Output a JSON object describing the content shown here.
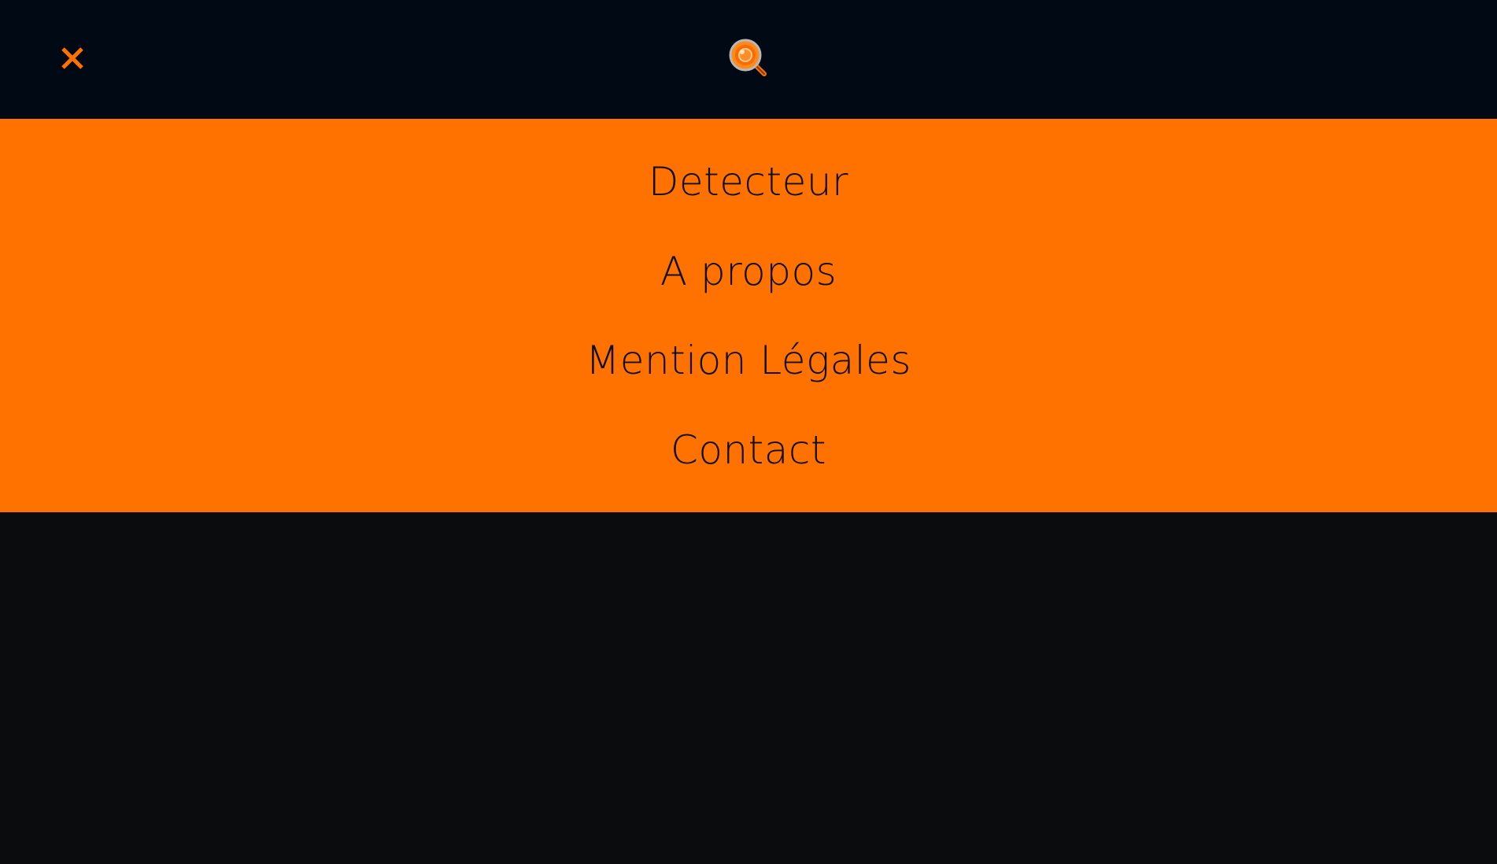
{
  "header": {
    "close_icon": "close-icon",
    "logo_icon": "magnifier-logo-icon"
  },
  "menu": {
    "items": [
      {
        "label": "Detecteur"
      },
      {
        "label": "A propos"
      },
      {
        "label": "Mention Légales"
      },
      {
        "label": "Contact"
      }
    ]
  },
  "colors": {
    "header_bg": "#000914",
    "menu_bg": "#ff7200",
    "page_bg": "#0b0c0e",
    "accent": "#ff7200",
    "menu_text": "#0d0d12"
  }
}
